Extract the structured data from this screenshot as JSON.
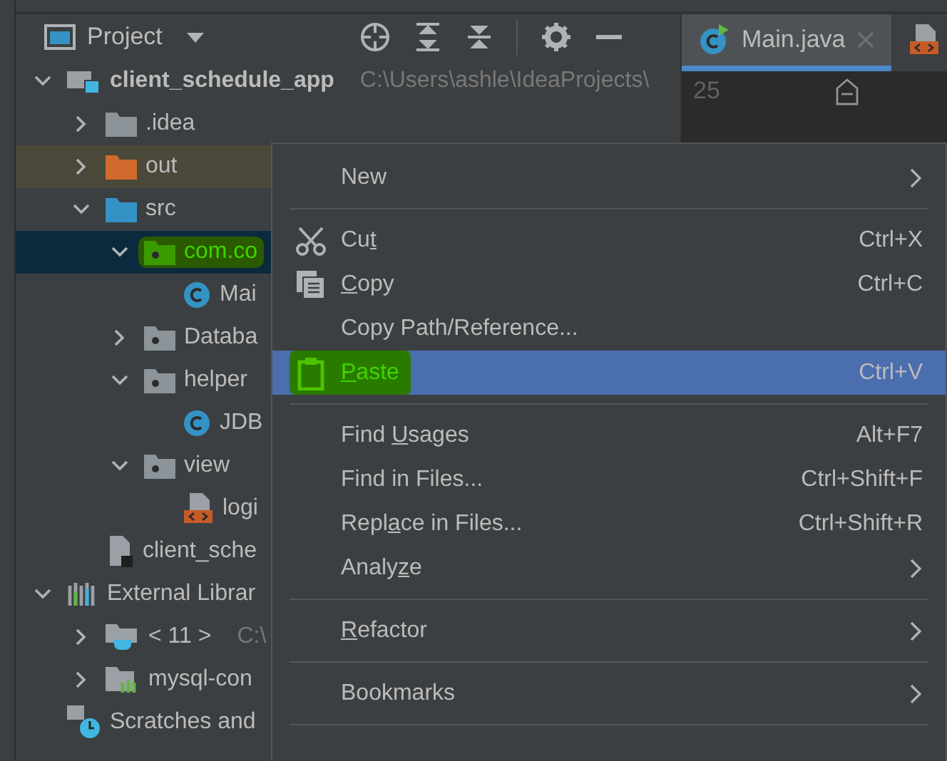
{
  "panel": {
    "title": "Project"
  },
  "editor_tabs": [
    {
      "label": "Main.java",
      "kind": "class",
      "selected": true
    },
    {
      "kind": "markup",
      "selected": false
    }
  ],
  "editor": {
    "line_numbers": [
      "25"
    ]
  },
  "tree": [
    {
      "label": "client_schedule_app",
      "path": "C:\\Users\\ashle\\IdeaProjects\\",
      "kind": "module",
      "expanded": true,
      "selected": false,
      "highlighted": false,
      "children": [
        {
          "label": ".idea",
          "kind": "folder",
          "expanded": false,
          "selected": false,
          "highlighted": false
        },
        {
          "label": "out",
          "kind": "excluded",
          "expanded": false,
          "selected": false,
          "highlighted": false
        },
        {
          "label": "src",
          "kind": "source",
          "expanded": true,
          "selected": false,
          "highlighted": false,
          "children": [
            {
              "label": "com.co",
              "kind": "package",
              "expanded": true,
              "selected": true,
              "highlighted": true,
              "children": [
                {
                  "label": "Mai",
                  "kind": "class",
                  "selected": false,
                  "highlighted": false
                }
              ]
            },
            {
              "label": "Databa",
              "kind": "package",
              "expanded": false,
              "selected": false,
              "highlighted": false
            },
            {
              "label": "helper",
              "kind": "package",
              "expanded": true,
              "selected": false,
              "highlighted": false,
              "children": [
                {
                  "label": "JDB",
                  "kind": "class",
                  "selected": false,
                  "highlighted": false
                }
              ]
            },
            {
              "label": "view",
              "kind": "package",
              "expanded": true,
              "selected": false,
              "highlighted": false,
              "children": [
                {
                  "label": "logi",
                  "kind": "markup",
                  "selected": false,
                  "highlighted": false
                }
              ]
            }
          ]
        },
        {
          "label": "client_sche",
          "kind": "file",
          "selected": false,
          "highlighted": false
        }
      ]
    },
    {
      "label": "External Librar",
      "kind": "libraries",
      "expanded": true,
      "selected": false,
      "highlighted": false,
      "children": [
        {
          "label": "< 11 >",
          "path": "C:\\",
          "kind": "jdk",
          "expanded": false,
          "selected": false,
          "highlighted": false
        },
        {
          "label": "mysql-con",
          "kind": "library",
          "expanded": false,
          "selected": false,
          "highlighted": false
        }
      ]
    },
    {
      "label": "Scratches and",
      "kind": "scratches",
      "selected": false,
      "highlighted": false
    }
  ],
  "context_menu": [
    {
      "kind": "item",
      "before": "New",
      "submenu": true,
      "selected": false,
      "highlighted": false
    },
    {
      "kind": "separator"
    },
    {
      "kind": "cut",
      "before": "Cu",
      "mnemonic": "t",
      "shortcut": "Ctrl+X",
      "submenu": false,
      "selected": false,
      "highlighted": false
    },
    {
      "kind": "copy",
      "mnemonic": "C",
      "after": "opy",
      "shortcut": "Ctrl+C",
      "submenu": false,
      "selected": false,
      "highlighted": false
    },
    {
      "kind": "item",
      "before": "Copy Path/Reference...",
      "submenu": false,
      "selected": false,
      "highlighted": false
    },
    {
      "kind": "paste",
      "mnemonic": "P",
      "after": "aste",
      "shortcut": "Ctrl+V",
      "submenu": false,
      "selected": true,
      "highlighted": true
    },
    {
      "kind": "separator"
    },
    {
      "kind": "item",
      "before": "Find ",
      "mnemonic": "U",
      "after": "sages",
      "shortcut": "Alt+F7",
      "submenu": false,
      "selected": false,
      "highlighted": false
    },
    {
      "kind": "item",
      "before": "Find in Files...",
      "shortcut": "Ctrl+Shift+F",
      "submenu": false,
      "selected": false,
      "highlighted": false
    },
    {
      "kind": "item",
      "before": "Repl",
      "mnemonic": "a",
      "after": "ce in Files...",
      "shortcut": "Ctrl+Shift+R",
      "submenu": false,
      "selected": false,
      "highlighted": false
    },
    {
      "kind": "item",
      "before": "Analy",
      "mnemonic": "z",
      "after": "e",
      "submenu": true,
      "selected": false,
      "highlighted": false
    },
    {
      "kind": "separator"
    },
    {
      "kind": "item",
      "mnemonic": "R",
      "after": "efactor",
      "submenu": true,
      "selected": false,
      "highlighted": false
    },
    {
      "kind": "separator"
    },
    {
      "kind": "item",
      "before": "Bookmarks",
      "submenu": true,
      "selected": false,
      "highlighted": false
    },
    {
      "kind": "separator"
    }
  ]
}
